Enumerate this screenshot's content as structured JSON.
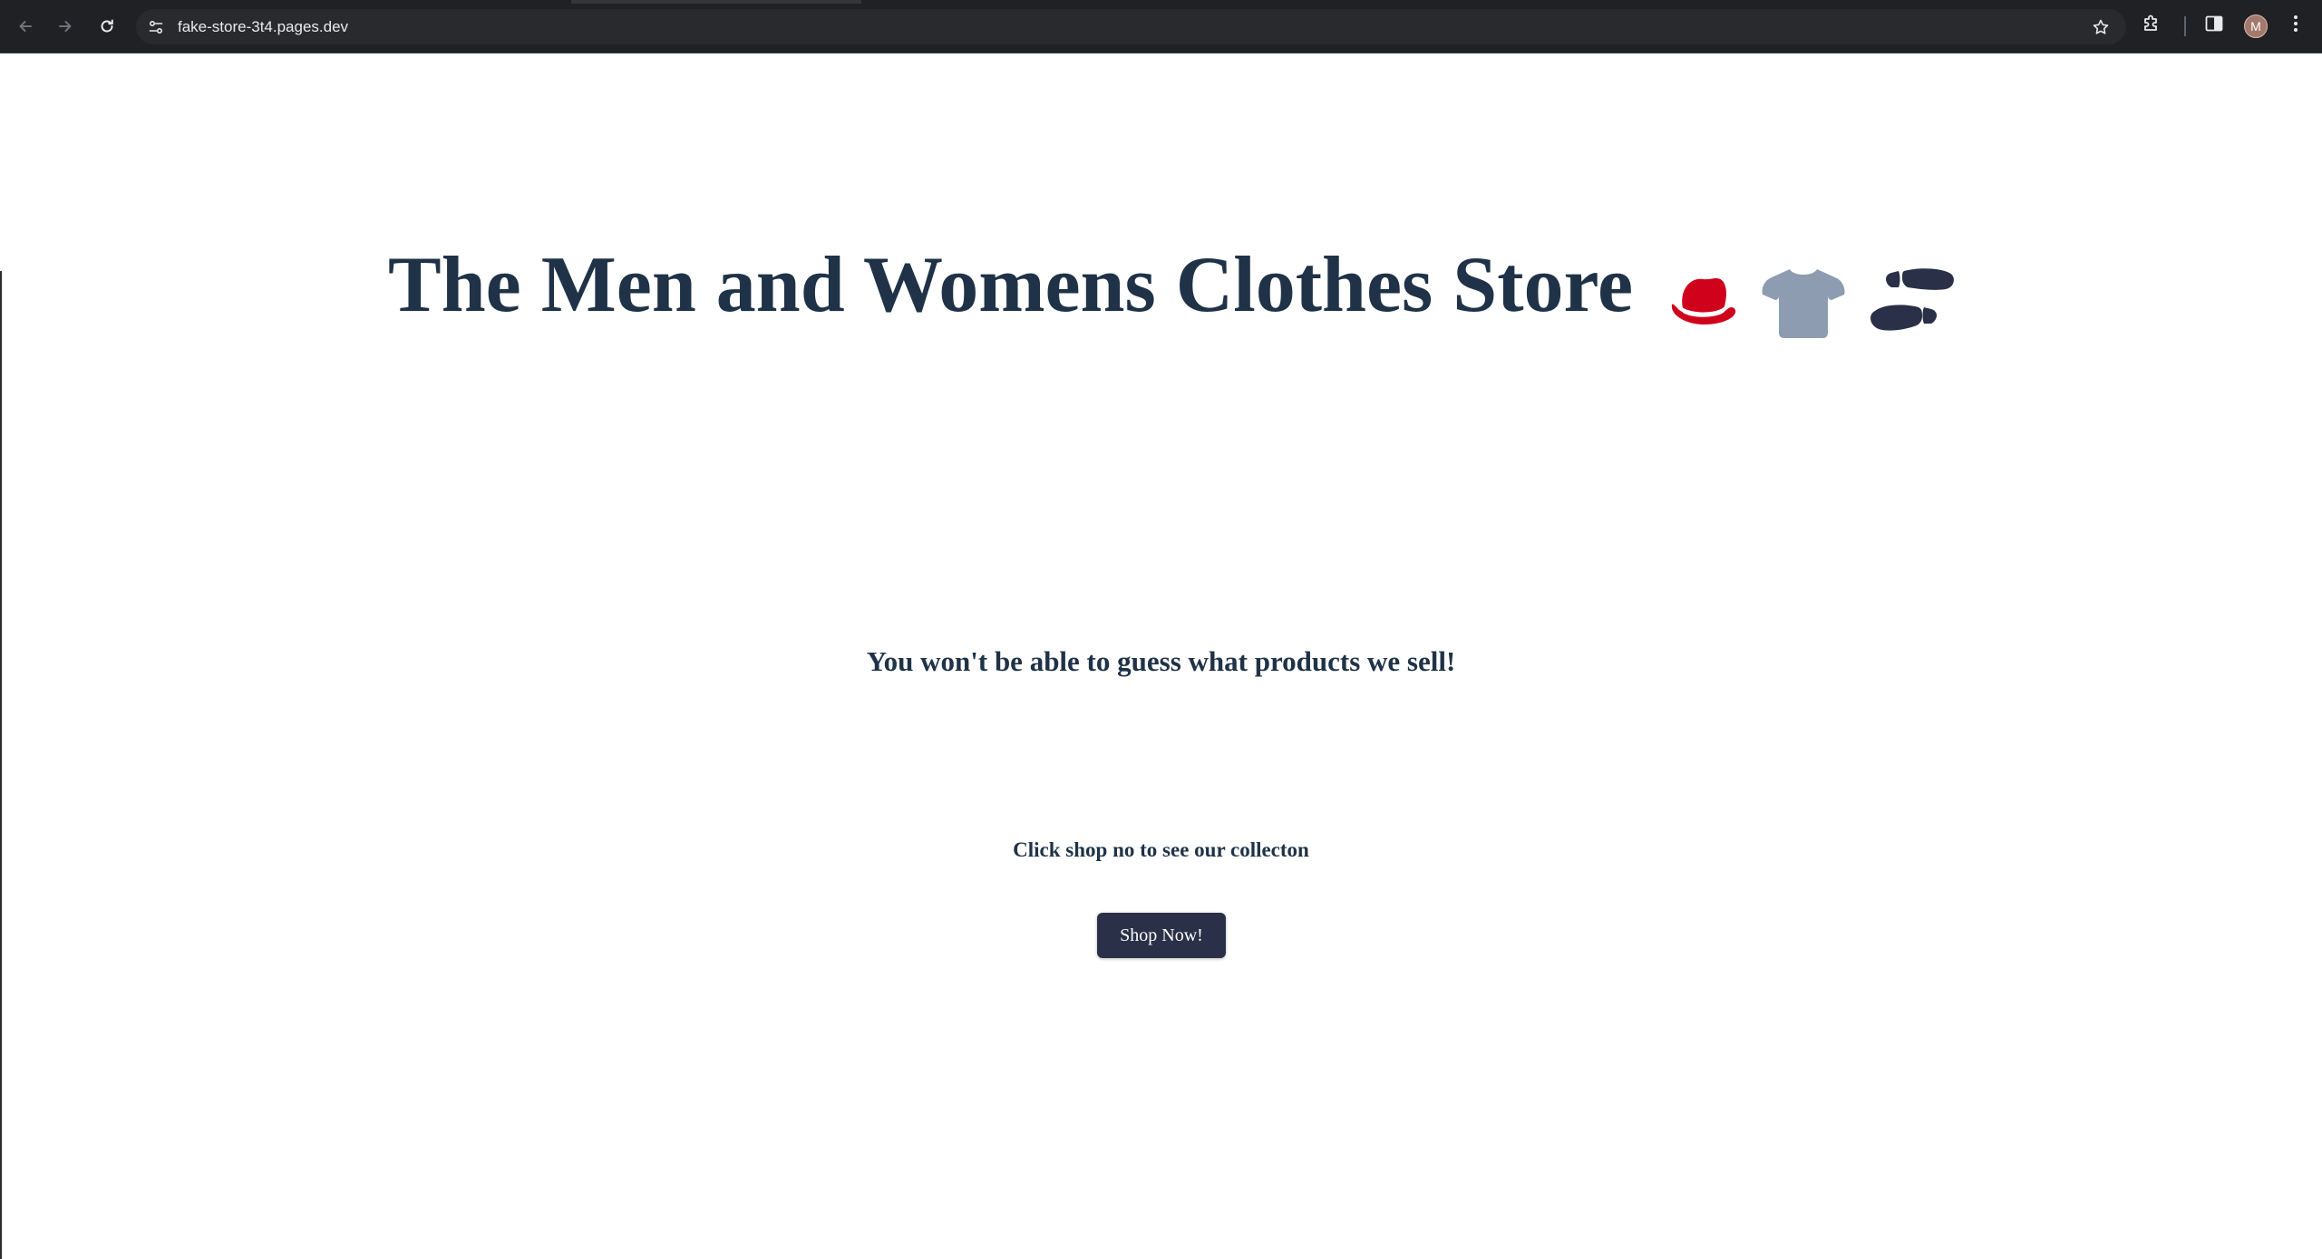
{
  "browser": {
    "url": "fake-store-3t4.pages.dev",
    "profile_initial": "M",
    "icons": [
      "back-icon",
      "forward-icon",
      "reload-icon",
      "site-info-icon",
      "star-icon",
      "extensions-icon",
      "side-panel-icon",
      "menu-icon"
    ]
  },
  "page": {
    "title": "The Men and Womens Clothes Store",
    "title_icons": [
      "hat-icon",
      "tshirt-icon",
      "shoe-prints-icon"
    ],
    "tagline": "You won't be able to guess what products we sell!",
    "cta_text": "Click shop no to see our collecton",
    "shop_button_label": "Shop Now!"
  },
  "colors": {
    "chrome": "#202124",
    "text_primary": "#1f3247",
    "button_bg": "#2a3047",
    "hat": "#d0021b",
    "tshirt": "#8e9cb2",
    "shoes": "#2a3047"
  }
}
